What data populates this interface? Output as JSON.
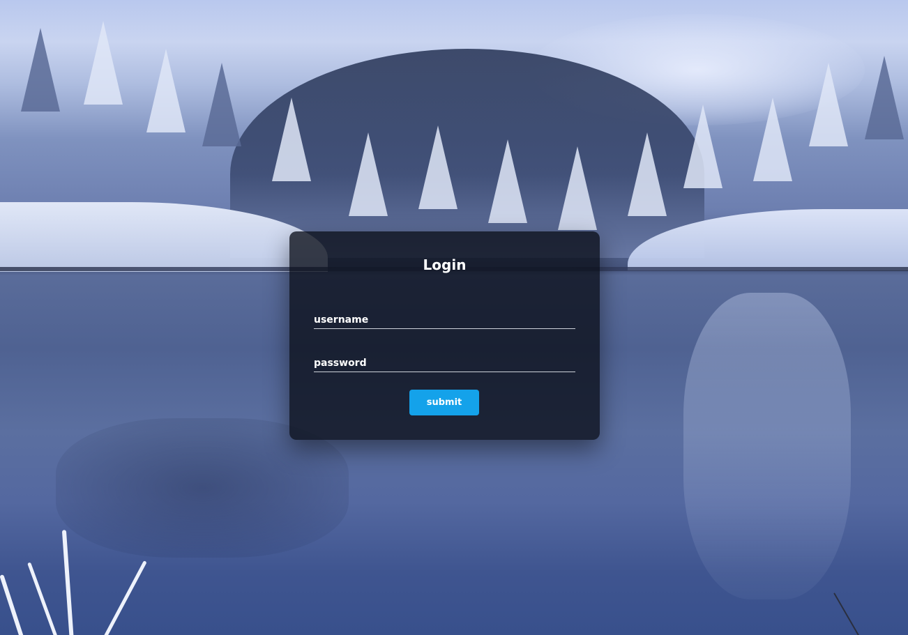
{
  "login": {
    "title": "Login",
    "username_placeholder": "username",
    "password_placeholder": "password",
    "submit_label": "submit"
  },
  "colors": {
    "button_accent": "#14a2ea",
    "card_background": "rgba(10,14,24,0.78)"
  }
}
